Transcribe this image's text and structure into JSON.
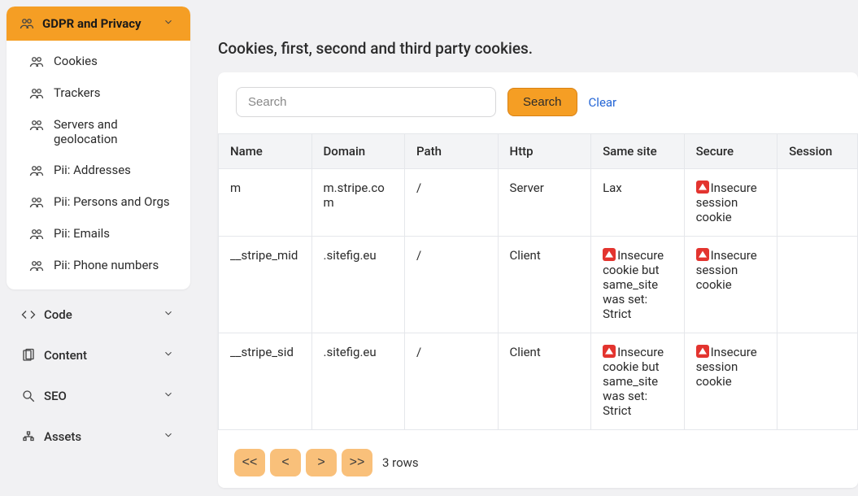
{
  "sidebar": {
    "active_section": {
      "label": "GDPR and Privacy",
      "items": [
        "Cookies",
        "Trackers",
        "Servers and geolocation",
        "Pii: Addresses",
        "Pii: Persons and Orgs",
        "Pii: Emails",
        "Pii: Phone numbers"
      ]
    },
    "collapsed_sections": [
      "Code",
      "Content",
      "SEO",
      "Assets"
    ]
  },
  "page": {
    "title": "Cookies, first, second and third party cookies."
  },
  "toolbar": {
    "search_placeholder": "Search",
    "search_label": "Search",
    "clear_label": "Clear"
  },
  "table": {
    "headers": [
      "Name",
      "Domain",
      "Path",
      "Http",
      "Same site",
      "Secure",
      "Session"
    ],
    "rows": [
      {
        "name": "m",
        "domain": "m.stripe.com",
        "path": "/",
        "http": "Server",
        "same_site": {
          "warn": false,
          "text": "Lax"
        },
        "secure": {
          "warn": true,
          "text": "Insecure session cookie"
        },
        "session": ""
      },
      {
        "name": "__stripe_mid",
        "domain": ".sitefig.eu",
        "path": "/",
        "http": "Client",
        "same_site": {
          "warn": true,
          "text": "Insecure cookie but same_site was set: Strict"
        },
        "secure": {
          "warn": true,
          "text": "Insecure session cookie"
        },
        "session": ""
      },
      {
        "name": "__stripe_sid",
        "domain": ".sitefig.eu",
        "path": "/",
        "http": "Client",
        "same_site": {
          "warn": true,
          "text": "Insecure cookie but same_site was set: Strict"
        },
        "secure": {
          "warn": true,
          "text": "Insecure session cookie"
        },
        "session": ""
      }
    ]
  },
  "pager": {
    "first": "<<",
    "prev": "<",
    "next": ">",
    "last": ">>",
    "count_label": "3 rows"
  },
  "colors": {
    "accent_orange": "#f59e24",
    "danger_red": "#e3342f",
    "link_blue": "#2466d6"
  }
}
